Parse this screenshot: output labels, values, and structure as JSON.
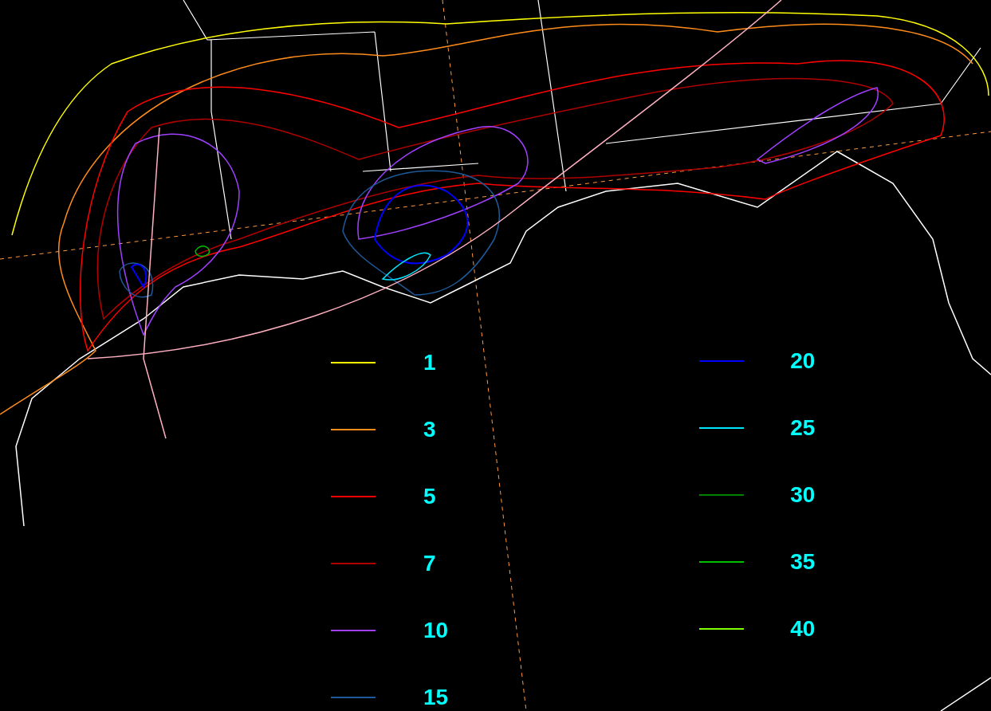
{
  "legend": {
    "columns": [
      {
        "items": [
          {
            "label": "1",
            "color": "#ffff00"
          },
          {
            "label": "3",
            "color": "#ff8c1a"
          },
          {
            "label": "5",
            "color": "#ff0000"
          },
          {
            "label": "7",
            "color": "#b00000"
          },
          {
            "label": "10",
            "color": "#a040ff"
          },
          {
            "label": "15",
            "color": "#1e5a9a"
          }
        ]
      },
      {
        "items": [
          {
            "label": "20",
            "color": "#0000ff"
          },
          {
            "label": "25",
            "color": "#00e5ff"
          },
          {
            "label": "30",
            "color": "#008000"
          },
          {
            "label": "35",
            "color": "#00c000"
          },
          {
            "label": "40",
            "color": "#80ff00"
          }
        ]
      }
    ]
  }
}
